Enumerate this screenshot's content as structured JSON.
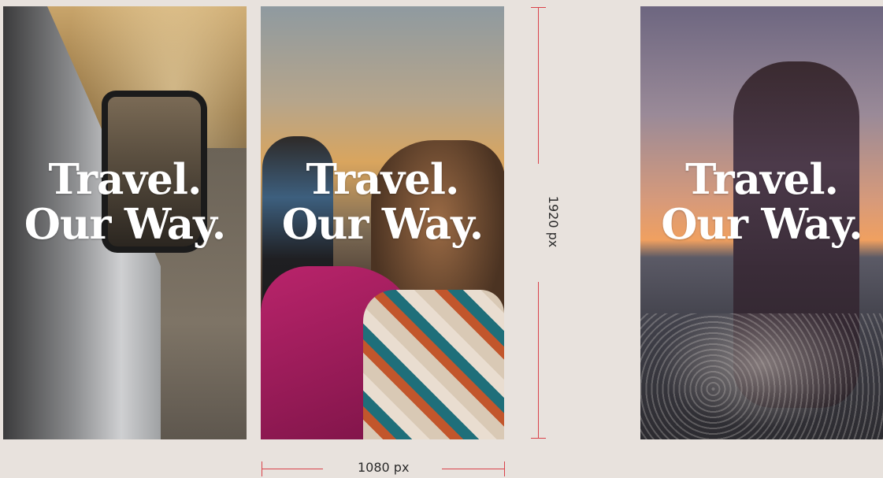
{
  "panels": [
    {
      "id": "panel-1",
      "headline": [
        "Travel.",
        "Our Way."
      ]
    },
    {
      "id": "panel-2",
      "headline": [
        "Travel.",
        "Our Way."
      ]
    },
    {
      "id": "panel-3",
      "headline": [
        "Travel.",
        "Our Way."
      ]
    }
  ],
  "dimensions": {
    "height_label": "1920 px",
    "width_label": "1080 px",
    "guide_color": "#d9424a"
  },
  "colors": {
    "background": "#e8e2dd",
    "headline": "#ffffff"
  }
}
